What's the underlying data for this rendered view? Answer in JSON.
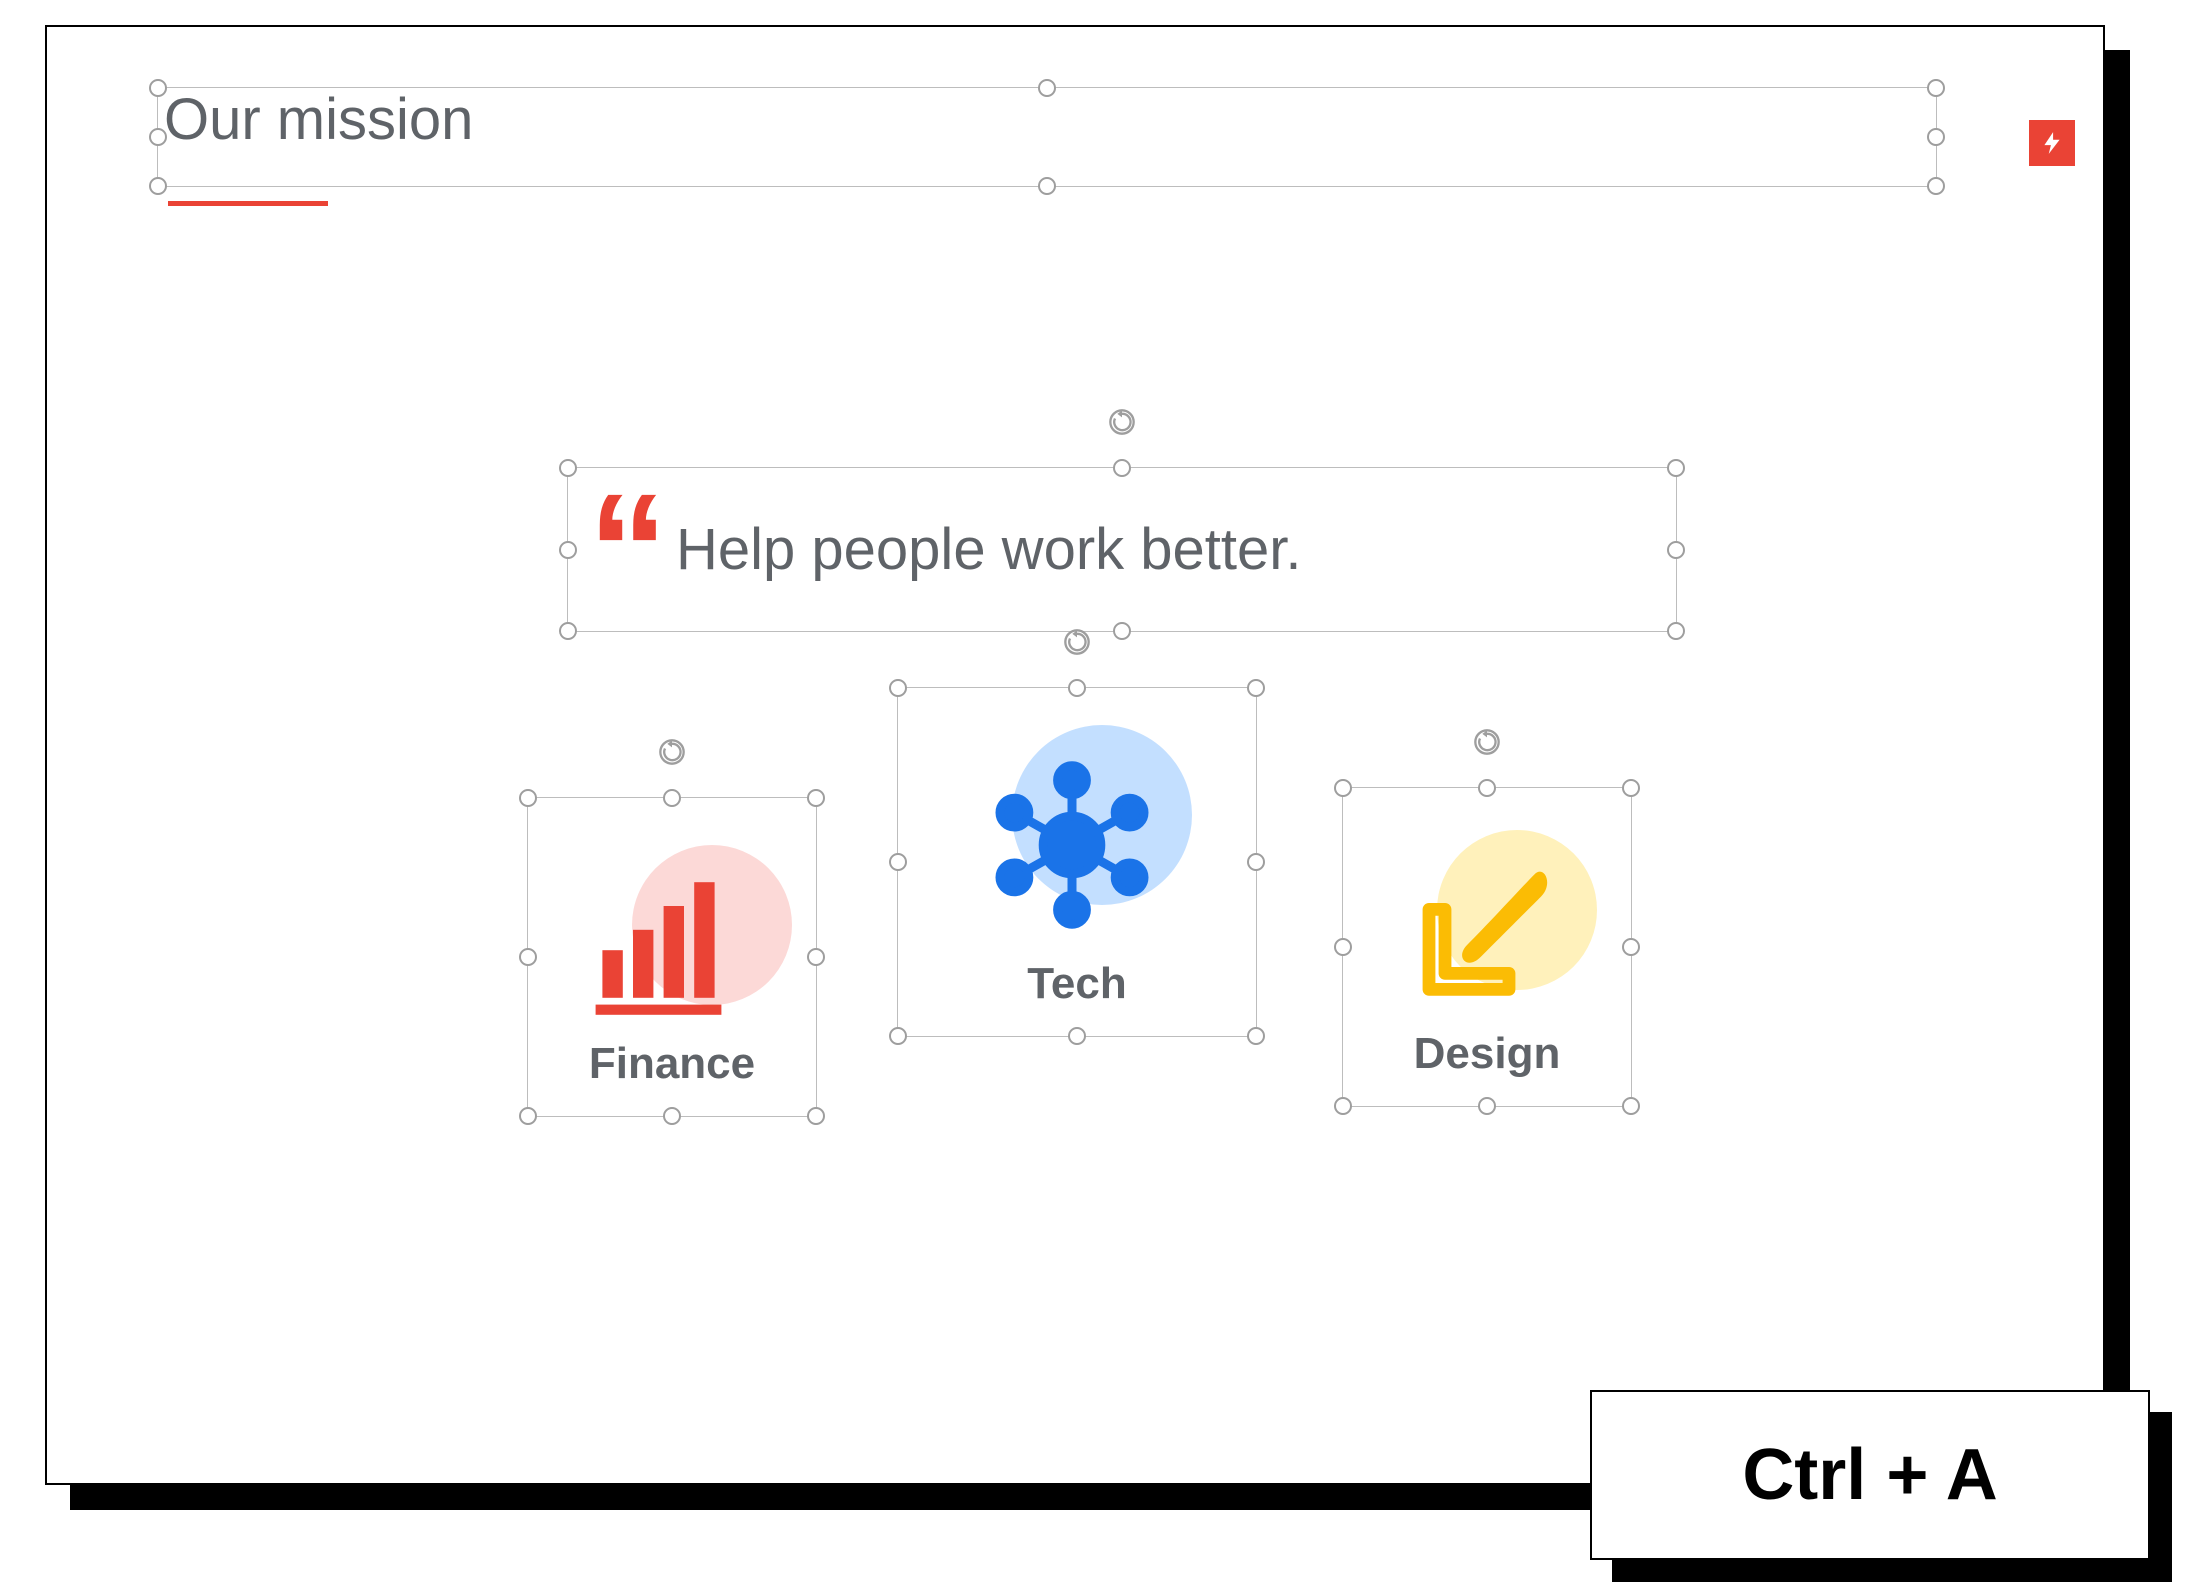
{
  "slide": {
    "title": "Our mission",
    "quote": "Help people work better.",
    "categories": [
      {
        "label": "Finance",
        "icon": "bar-chart-icon",
        "bg": "#fcd9d7",
        "fg": "#ea4335"
      },
      {
        "label": "Tech",
        "icon": "network-icon",
        "bg": "#c3dfff",
        "fg": "#1a73e8"
      },
      {
        "label": "Design",
        "icon": "paintbrush-icon",
        "bg": "#fff1bb",
        "fg": "#fbbc04"
      }
    ],
    "badge_icon": "lightning-icon",
    "accent_color": "#ea4335"
  },
  "shortcut": {
    "label": "Ctrl + A"
  }
}
